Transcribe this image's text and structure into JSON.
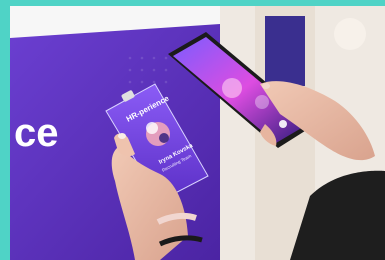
{
  "scene": {
    "description_label": "",
    "wall_text": "ce",
    "badge": {
      "event_name": "HR-perience",
      "person_name": "Iryna Kovska",
      "person_subtitle": "Recruiting Team"
    },
    "colors": {
      "frame": "#4fd3c6",
      "wall_purple": "#5a2fb8",
      "badge_purple": "#6d43d6"
    }
  }
}
